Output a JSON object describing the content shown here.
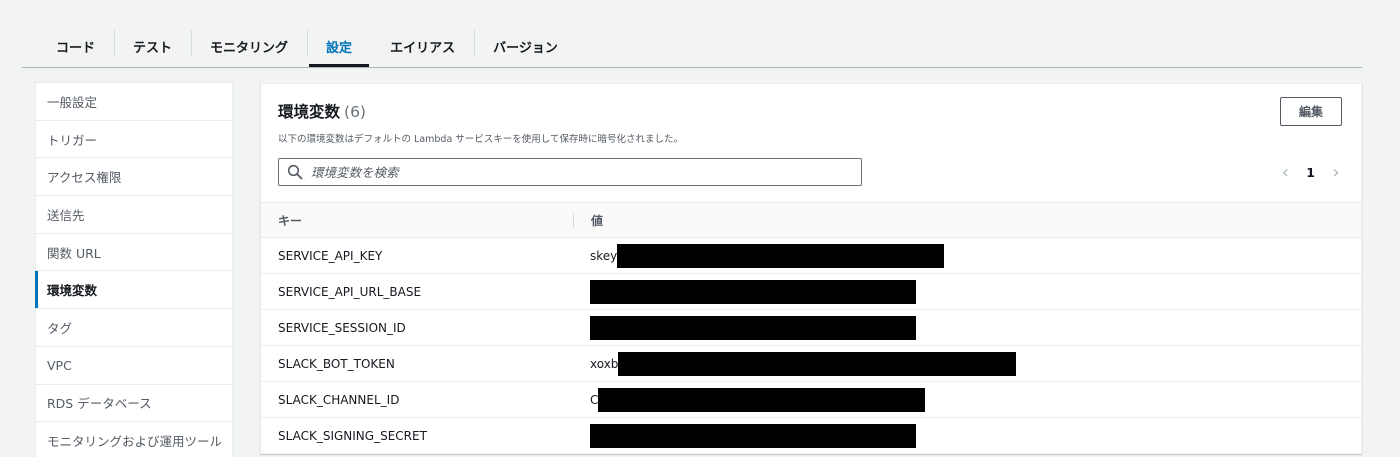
{
  "tabs": [
    {
      "label": "コード",
      "active": false
    },
    {
      "label": "テスト",
      "active": false
    },
    {
      "label": "モニタリング",
      "active": false
    },
    {
      "label": "設定",
      "active": true
    },
    {
      "label": "エイリアス",
      "active": false
    },
    {
      "label": "バージョン",
      "active": false
    }
  ],
  "sidebar": {
    "items": [
      {
        "label": "一般設定"
      },
      {
        "label": "トリガー"
      },
      {
        "label": "アクセス権限"
      },
      {
        "label": "送信先"
      },
      {
        "label": "関数 URL"
      },
      {
        "label": "環境変数",
        "active": true
      },
      {
        "label": "タグ"
      },
      {
        "label": "VPC"
      },
      {
        "label": "RDS データベース"
      },
      {
        "label": "モニタリングおよび運用ツール"
      }
    ]
  },
  "panel": {
    "title": "環境変数",
    "count": "(6)",
    "description": "以下の環境変数はデフォルトの Lambda サービスキーを使用して保存時に暗号化されました。",
    "edit_label": "編集",
    "search_placeholder": "環境変数を検索",
    "page_number": "1",
    "columns": {
      "key": "キー",
      "value": "値"
    },
    "rows": [
      {
        "key": "SERVICE_API_KEY",
        "value_prefix": "skey"
      },
      {
        "key": "SERVICE_API_URL_BASE",
        "value_prefix": ""
      },
      {
        "key": "SERVICE_SESSION_ID",
        "value_prefix": ""
      },
      {
        "key": "SLACK_BOT_TOKEN",
        "value_prefix": "xoxb"
      },
      {
        "key": "SLACK_CHANNEL_ID",
        "value_prefix": "C"
      },
      {
        "key": "SLACK_SIGNING_SECRET",
        "value_prefix": ""
      }
    ]
  },
  "colors": {
    "accent": "#0073bb",
    "redaction": "#000000"
  },
  "icons": {
    "search": "search-icon",
    "prev": "chevron-left-icon",
    "next": "chevron-right-icon"
  }
}
